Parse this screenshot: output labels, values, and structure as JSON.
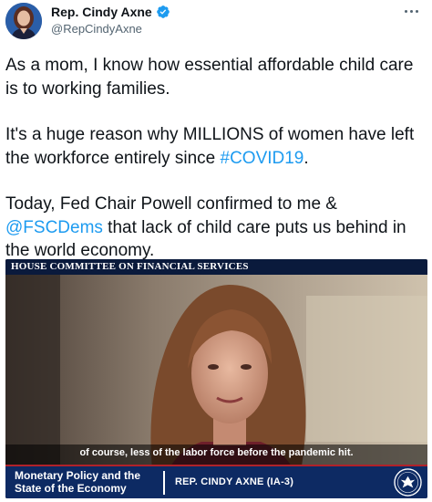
{
  "author": {
    "display_name": "Rep. Cindy Axne",
    "handle": "@RepCindyAxne",
    "verified": true
  },
  "tweet": {
    "p1": "As a mom, I know how essential affordable child care is to working families.",
    "p2_before": "It's a huge reason why MILLIONS of women have left the workforce entirely since ",
    "p2_link": "#COVID19",
    "p2_after": ".",
    "p3_before": "Today, Fed Chair Powell confirmed to me & ",
    "p3_link": "@FSCDems",
    "p3_after": " that lack of child care puts us behind in the world economy."
  },
  "media": {
    "banner": "HOUSE COMMITTEE ON FINANCIAL SERVICES",
    "caption": "of course, less of the labor force before the pandemic hit.",
    "program_title": "Monetary Policy and the State of the Economy",
    "speaker": "REP. CINDY AXNE (IA-3)"
  },
  "colors": {
    "link": "#1d9bf0",
    "verified": "#1d9bf0",
    "banner": "#0a1a3c",
    "lower_third": "#0d2a63"
  },
  "icons": {
    "verified": "verified-badge-icon",
    "more": "more-options-icon",
    "seal": "house-seal-icon"
  }
}
